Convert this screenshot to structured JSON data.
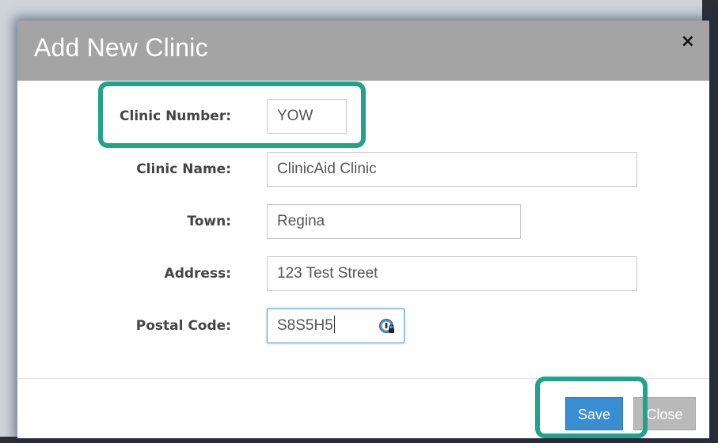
{
  "dialog": {
    "title": "Add New Clinic",
    "close_glyph": "×"
  },
  "form": {
    "clinic_number": {
      "label": "Clinic Number:",
      "value": "YOW"
    },
    "clinic_name": {
      "label": "Clinic Name:",
      "value": "ClinicAid Clinic"
    },
    "town": {
      "label": "Town:",
      "value": "Regina"
    },
    "address": {
      "label": "Address:",
      "value": "123 Test Street"
    },
    "postal_code": {
      "label": "Postal Code:",
      "value": "S8S5H5",
      "icon": "password-manager-icon"
    }
  },
  "footer": {
    "save_label": "Save",
    "close_label": "Close"
  },
  "colors": {
    "header_bg": "#a4a4a4",
    "highlight": "#1fa38a",
    "save_bg": "#3a8dd0",
    "close_bg": "#b9b9b9"
  }
}
